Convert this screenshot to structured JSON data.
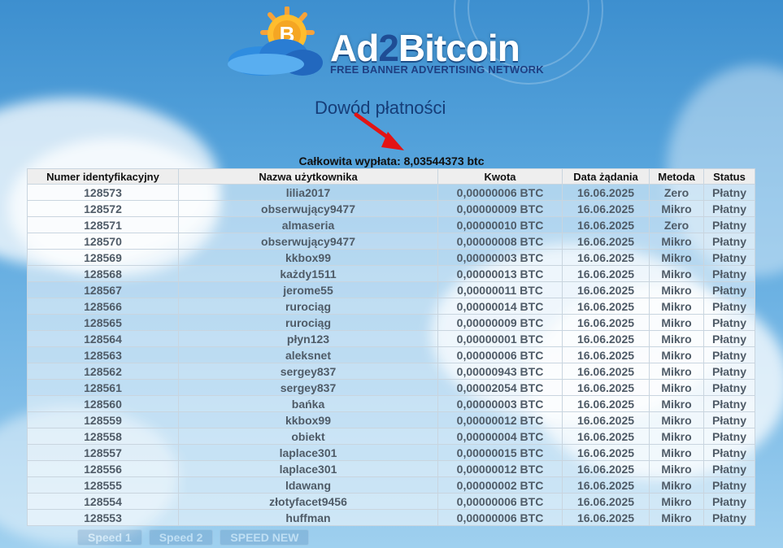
{
  "branding": {
    "name_prefix": "Ad",
    "name_mid": "2",
    "name_suffix": "Bitcoin",
    "tagline": "FREE BANNER ADVERTISING NETWORK"
  },
  "page": {
    "title": "Dowód płatności",
    "total_payout": "Całkowita wypłata: 8,03544373 btc"
  },
  "table": {
    "headers": [
      "Numer identyfikacyjny",
      "Nazwa użytkownika",
      "Kwota",
      "Data żądania",
      "Metoda",
      "Status"
    ],
    "rows": [
      {
        "id": "128573",
        "user": "lilia2017",
        "amount": "0,00000006 BTC",
        "date": "16.06.2025",
        "method": "Zero",
        "status": "Płatny"
      },
      {
        "id": "128572",
        "user": "obserwujący9477",
        "amount": "0,00000009 BTC",
        "date": "16.06.2025",
        "method": "Mikro",
        "status": "Płatny"
      },
      {
        "id": "128571",
        "user": "almaseria",
        "amount": "0,00000010 BTC",
        "date": "16.06.2025",
        "method": "Zero",
        "status": "Płatny"
      },
      {
        "id": "128570",
        "user": "obserwujący9477",
        "amount": "0,00000008 BTC",
        "date": "16.06.2025",
        "method": "Mikro",
        "status": "Płatny"
      },
      {
        "id": "128569",
        "user": "kkbox99",
        "amount": "0,00000003 BTC",
        "date": "16.06.2025",
        "method": "Mikro",
        "status": "Płatny"
      },
      {
        "id": "128568",
        "user": "każdy1511",
        "amount": "0,00000013 BTC",
        "date": "16.06.2025",
        "method": "Mikro",
        "status": "Płatny"
      },
      {
        "id": "128567",
        "user": "jerome55",
        "amount": "0,00000011 BTC",
        "date": "16.06.2025",
        "method": "Mikro",
        "status": "Płatny"
      },
      {
        "id": "128566",
        "user": "rurociąg",
        "amount": "0,00000014 BTC",
        "date": "16.06.2025",
        "method": "Mikro",
        "status": "Płatny"
      },
      {
        "id": "128565",
        "user": "rurociąg",
        "amount": "0,00000009 BTC",
        "date": "16.06.2025",
        "method": "Mikro",
        "status": "Płatny"
      },
      {
        "id": "128564",
        "user": "płyn123",
        "amount": "0,00000001 BTC",
        "date": "16.06.2025",
        "method": "Mikro",
        "status": "Płatny"
      },
      {
        "id": "128563",
        "user": "aleksnet",
        "amount": "0,00000006 BTC",
        "date": "16.06.2025",
        "method": "Mikro",
        "status": "Płatny"
      },
      {
        "id": "128562",
        "user": "sergey837",
        "amount": "0,00000943 BTC",
        "date": "16.06.2025",
        "method": "Mikro",
        "status": "Płatny"
      },
      {
        "id": "128561",
        "user": "sergey837",
        "amount": "0,00002054 BTC",
        "date": "16.06.2025",
        "method": "Mikro",
        "status": "Płatny"
      },
      {
        "id": "128560",
        "user": "bańka",
        "amount": "0,00000003 BTC",
        "date": "16.06.2025",
        "method": "Mikro",
        "status": "Płatny"
      },
      {
        "id": "128559",
        "user": "kkbox99",
        "amount": "0,00000012 BTC",
        "date": "16.06.2025",
        "method": "Mikro",
        "status": "Płatny"
      },
      {
        "id": "128558",
        "user": "obiekt",
        "amount": "0,00000004 BTC",
        "date": "16.06.2025",
        "method": "Mikro",
        "status": "Płatny"
      },
      {
        "id": "128557",
        "user": "laplace301",
        "amount": "0,00000015 BTC",
        "date": "16.06.2025",
        "method": "Mikro",
        "status": "Płatny"
      },
      {
        "id": "128556",
        "user": "laplace301",
        "amount": "0,00000012 BTC",
        "date": "16.06.2025",
        "method": "Mikro",
        "status": "Płatny"
      },
      {
        "id": "128555",
        "user": "ldawang",
        "amount": "0,00000002 BTC",
        "date": "16.06.2025",
        "method": "Mikro",
        "status": "Płatny"
      },
      {
        "id": "128554",
        "user": "złotyfacet9456",
        "amount": "0,00000006 BTC",
        "date": "16.06.2025",
        "method": "Mikro",
        "status": "Płatny"
      },
      {
        "id": "128553",
        "user": "huffman",
        "amount": "0,00000006 BTC",
        "date": "16.06.2025",
        "method": "Mikro",
        "status": "Płatny"
      }
    ]
  },
  "footer_nav": {
    "items": [
      "Speed 1",
      "Speed 2",
      "SPEED NEW"
    ]
  }
}
